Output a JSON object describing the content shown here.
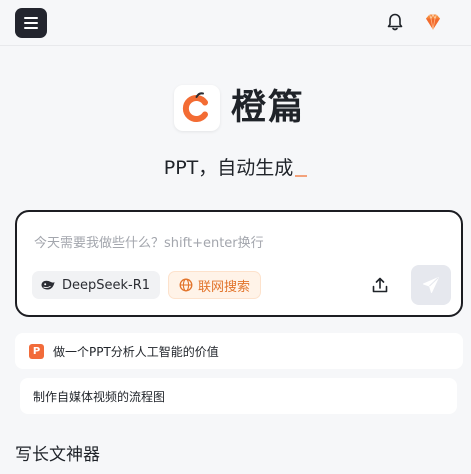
{
  "header": {
    "menu_icon": "hamburger-menu-icon",
    "notification_icon": "bell-icon",
    "premium_icon": "diamond-icon",
    "accent_color": "#f36c34"
  },
  "brand": {
    "name": "橙篇",
    "logo_icon": "orange-c-logo",
    "tagline": "PPT，自动生成"
  },
  "composer": {
    "placeholder": "今天需要我做些什么？shift+enter换行",
    "model_label": "DeepSeek-R1",
    "model_icon": "whale-icon",
    "web_search_label": "联网搜索",
    "web_search_icon": "globe-icon",
    "upload_icon": "upload-icon",
    "send_icon": "send-icon"
  },
  "suggestions": [
    {
      "badge": "P",
      "text": "做一个PPT分析人工智能的价值"
    },
    {
      "text": "制作自媒体视频的流程图"
    }
  ],
  "section": {
    "title": "写长文神器"
  }
}
